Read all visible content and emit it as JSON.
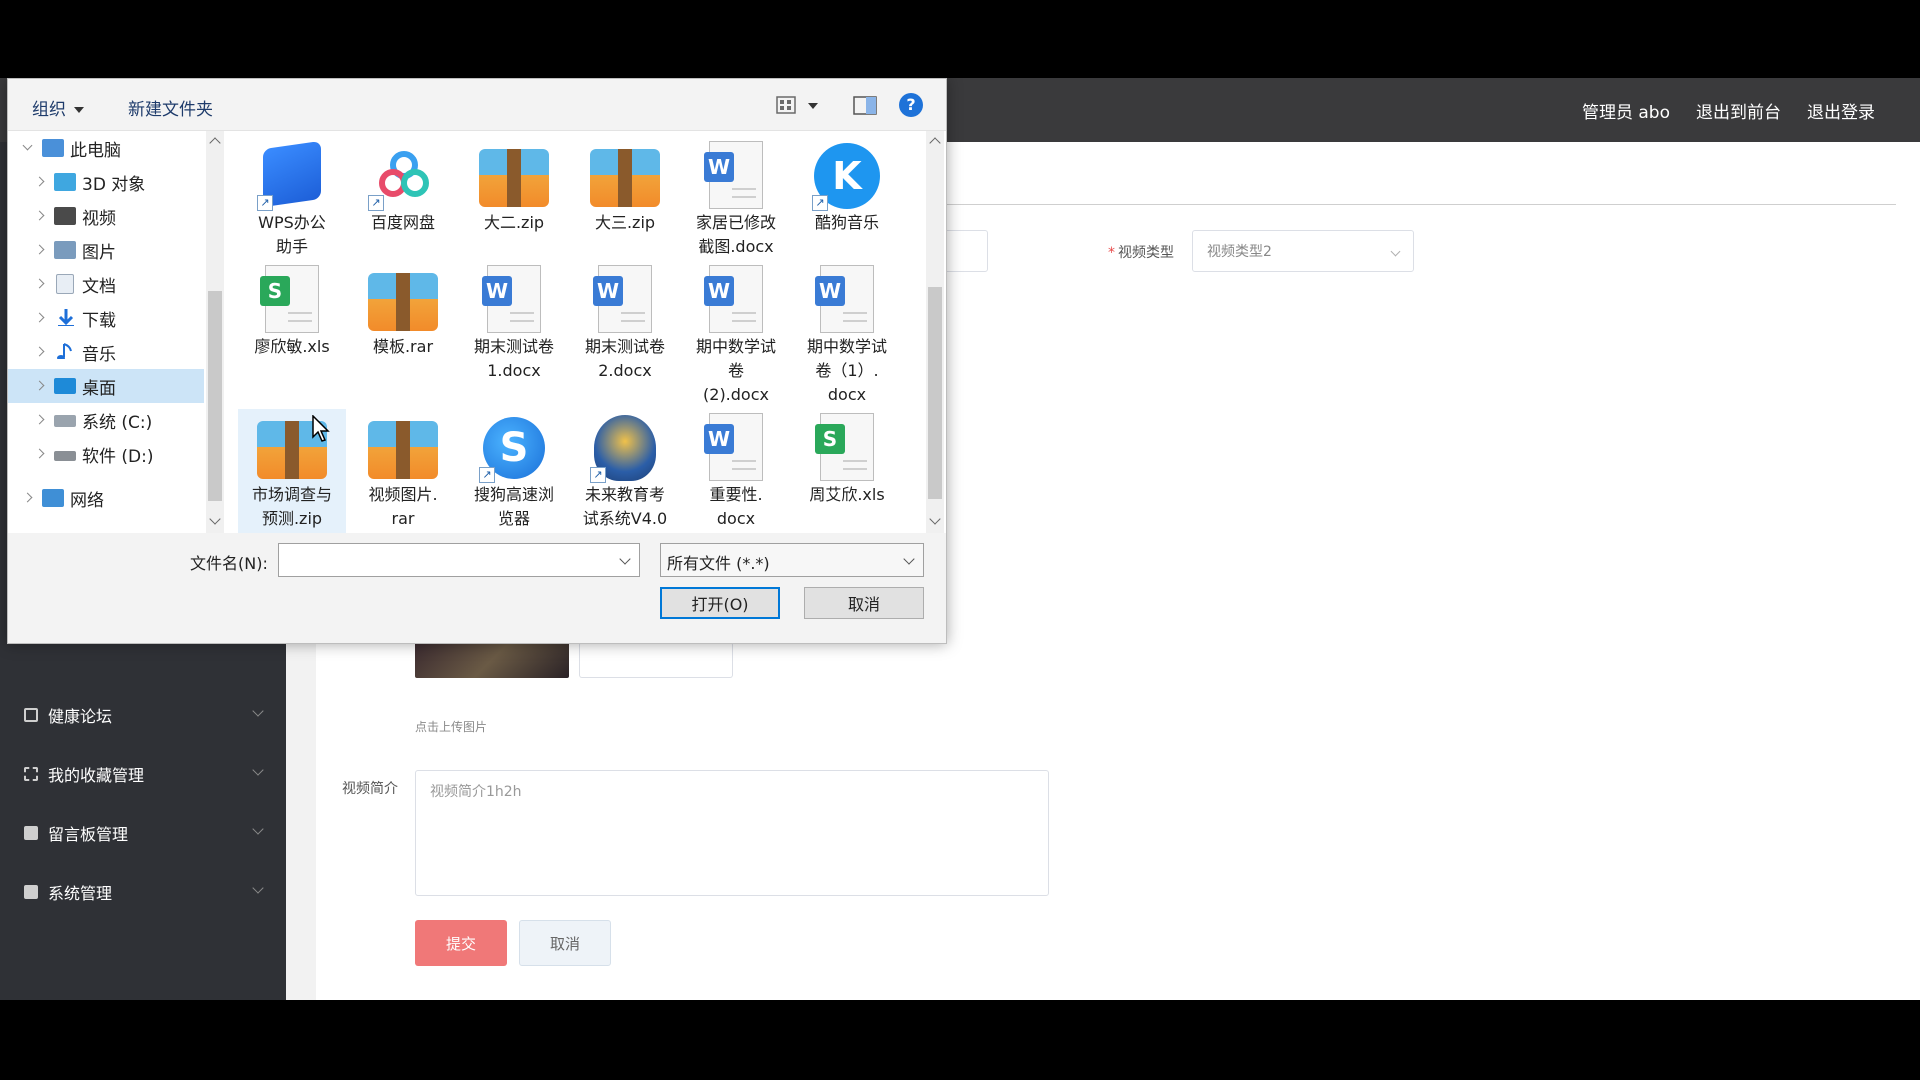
{
  "app": {
    "nav": {
      "admin": "管理员 abo",
      "front": "退出到前台",
      "logout": "退出登录"
    },
    "sidebar": [
      {
        "label": "健康论坛"
      },
      {
        "label": "我的收藏管理"
      },
      {
        "label": "留言板管理"
      },
      {
        "label": "系统管理"
      }
    ],
    "form": {
      "video_type_label": "视频类型",
      "video_type_value": "视频类型2",
      "upload_hint": "点击上传图片",
      "intro_label": "视频简介",
      "intro_value": "视频简介1h2h",
      "submit": "提交",
      "cancel": "取消"
    }
  },
  "dialog": {
    "toolbar": {
      "organize": "组织",
      "new_folder": "新建文件夹",
      "help": "?"
    },
    "tree": [
      {
        "label": "此电脑",
        "icon": "computer-icon",
        "level": 0,
        "open": true
      },
      {
        "label": "3D 对象",
        "icon": "3d-objects-icon",
        "level": 1
      },
      {
        "label": "视频",
        "icon": "video-folder-icon",
        "level": 1
      },
      {
        "label": "图片",
        "icon": "pictures-folder-icon",
        "level": 1
      },
      {
        "label": "文档",
        "icon": "documents-folder-icon",
        "level": 1
      },
      {
        "label": "下载",
        "icon": "download-folder-icon",
        "level": 1
      },
      {
        "label": "音乐",
        "icon": "music-folder-icon",
        "level": 1
      },
      {
        "label": "桌面",
        "icon": "desktop-folder-icon",
        "level": 1,
        "selected": true
      },
      {
        "label": "系统 (C:)",
        "icon": "system-drive-icon",
        "level": 1
      },
      {
        "label": "软件 (D:)",
        "icon": "drive-icon",
        "level": 1
      },
      {
        "label": "网络",
        "icon": "network-icon",
        "level": 0
      }
    ],
    "files": [
      {
        "name": "WPS办公\n助手",
        "type": "wps"
      },
      {
        "name": "百度网盘",
        "type": "baidu"
      },
      {
        "name": "大二.zip",
        "type": "zip"
      },
      {
        "name": "大三.zip",
        "type": "zip"
      },
      {
        "name": "家居已修改\n截图.docx",
        "type": "docx"
      },
      {
        "name": "酷狗音乐",
        "type": "kugou"
      },
      {
        "name": "廖欣敏.xls",
        "type": "xls"
      },
      {
        "name": "模板.rar",
        "type": "zip"
      },
      {
        "name": "期末测试卷\n1.docx",
        "type": "docx"
      },
      {
        "name": "期末测试卷\n2.docx",
        "type": "docx"
      },
      {
        "name": "期中数学试\n卷\n(2).docx",
        "type": "docx"
      },
      {
        "name": "期中数学试\n卷（1）.\ndocx",
        "type": "docx"
      },
      {
        "name": "市场调查与\n预测.zip",
        "type": "zip",
        "selected": true
      },
      {
        "name": "视频图片.\nrar",
        "type": "zip"
      },
      {
        "name": "搜狗高速浏\n览器",
        "type": "sogou"
      },
      {
        "name": "未来教育考\n试系统V4.0",
        "type": "future"
      },
      {
        "name": "重要性.\ndocx",
        "type": "docx"
      },
      {
        "name": "周艾欣.xls",
        "type": "xls"
      }
    ],
    "filename_label": "文件名(N):",
    "filename_value": "",
    "filetype_value": "所有文件 (*.*)",
    "open_button": "打开(O)",
    "cancel_button": "取消"
  },
  "colors": {
    "topbar": "#3a3a3c",
    "sidebar": "#2f3136",
    "submit": "#f07878",
    "selection": "#cce4f7",
    "accent": "#0078d7"
  }
}
